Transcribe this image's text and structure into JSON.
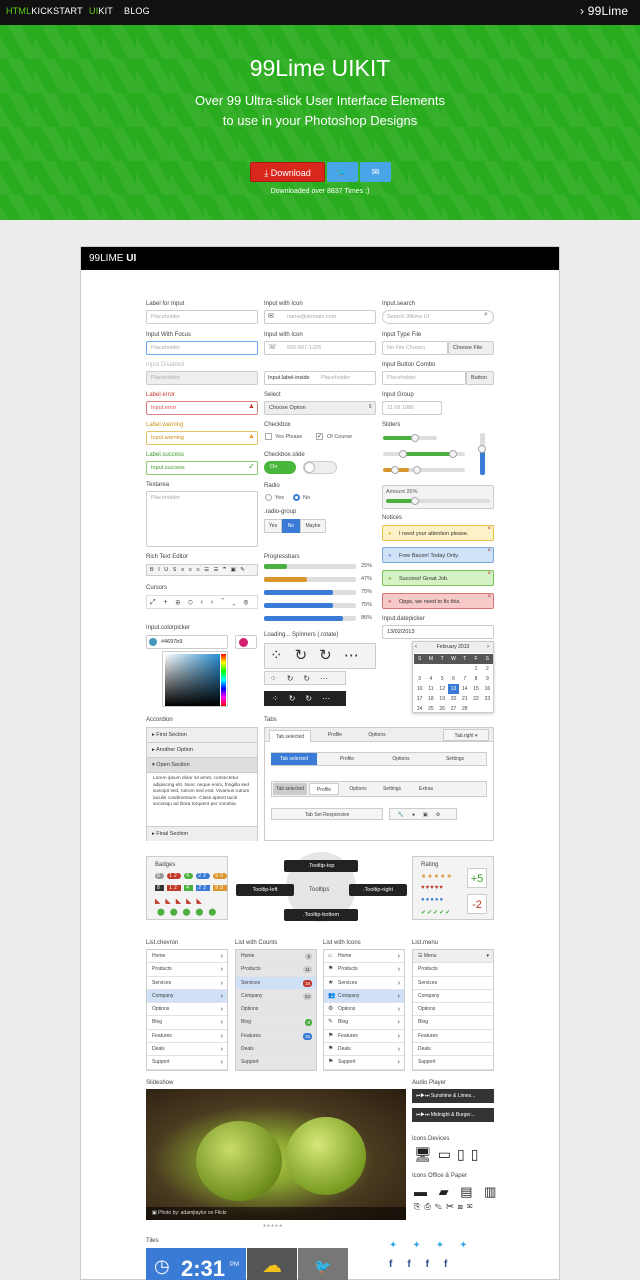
{
  "nav": {
    "brand_a": "HTML",
    "brand_b": "KICKSTART",
    "ui_a": "UI",
    "ui_b": "KIT",
    "blog": "BLOG",
    "logo": "› 99Lime"
  },
  "hero": {
    "title": "99Lime UIKIT",
    "subtitle1": "Over 99 Ultra-slick User Interface Elements",
    "subtitle2": "to use in your Photoshop Designs",
    "download": "Download",
    "downloaded": "Downloaded over 8837 Times :)"
  },
  "card": {
    "title_a": "99LIME ",
    "title_b": "UI"
  },
  "form": {
    "c1": [
      {
        "label": "Label for Input",
        "ph": "Placeholder"
      },
      {
        "label": "Input With Focus",
        "ph": "Placeholder"
      },
      {
        "label": "Input Disabled",
        "ph": "Placeholder"
      },
      {
        "label": "Label.error",
        "ph": "Input.error"
      },
      {
        "label": "Label.warning",
        "ph": "Input.warning"
      },
      {
        "label": "Label.success",
        "ph": "Input.success"
      }
    ],
    "textarea_label": "Textarea",
    "textarea_ph": "Placeholder",
    "c2": [
      {
        "label": "Input with Icon",
        "ph": "name@domain.com"
      },
      {
        "label": "Input with Icon",
        "ph": "555-567-1205"
      },
      {
        "label": "",
        "prefix": "Input.label-inside",
        "ph": "Placeholder"
      },
      {
        "label": "Select",
        "ph": "Choose Option"
      }
    ],
    "checkbox_label": "Checkbox",
    "cb1": "Yes Please",
    "cb2": "Of Course",
    "slide_label": "Checkbox.slide",
    "on": "On",
    "radio_label": "Radio",
    "r1": "Yes",
    "r2": "No",
    "radiogroup_label": ".radio-group",
    "rg": [
      "Yes",
      "No",
      "Maybe"
    ],
    "c3": [
      {
        "label": "Input.search",
        "ph": "Search 99lime UI"
      },
      {
        "label": "Input Type File",
        "ph": "No File Chosen",
        "btn": "Choose File"
      },
      {
        "label": "Input Button Combo",
        "ph": "Placeholder",
        "btn": "Button"
      },
      {
        "label": "Input Group",
        "ph": "11   09   1980"
      }
    ],
    "sliders_label": "Sliders",
    "amount": "Amount  26%"
  },
  "notices": {
    "label": "Notices",
    "items": [
      {
        "text": "I need your attention please.",
        "bg": "#fdf1c8",
        "bd": "#e4c24a"
      },
      {
        "text": "Free Bacon! Today Only.",
        "bg": "#cfe2f7",
        "bd": "#7aa6dc"
      },
      {
        "text": "Success! Great Job.",
        "bg": "#d4f2c4",
        "bd": "#7cc35a"
      },
      {
        "text": "Opps, we need to fix this.",
        "bg": "#f7c9c9",
        "bd": "#d97474"
      }
    ]
  },
  "rte": {
    "label": "Rich Text Editor",
    "cursors": "Cursors"
  },
  "progress": {
    "label": "Progressbars",
    "items": [
      {
        "v": 25,
        "t": "25%",
        "c": "#4caf3f"
      },
      {
        "v": 47,
        "t": "47%",
        "c": "#d9962e"
      },
      {
        "v": 75,
        "t": "75%",
        "c": "#3a7bd5"
      },
      {
        "v": 75,
        "t": "75%",
        "c": "#3a7bd5"
      },
      {
        "v": 86,
        "t": "86%",
        "c": "#3a7bd5"
      }
    ]
  },
  "color": {
    "label": "Input.colorpicker",
    "value": "#4697b9"
  },
  "spinners": {
    "label": "Loading... Spinners (.rotate)"
  },
  "datepicker": {
    "label": "Input.datepicker",
    "value": "13/02/2013",
    "month": "February 2013",
    "days": [
      "S",
      "M",
      "T",
      "W",
      "T",
      "F",
      "S"
    ],
    "rows": [
      [
        "",
        "",
        "",
        "",
        "",
        "1",
        "2"
      ],
      [
        "3",
        "4",
        "5",
        "6",
        "7",
        "8",
        "9"
      ],
      [
        "10",
        "11",
        "12",
        "13",
        "14",
        "15",
        "16"
      ],
      [
        "17",
        "18",
        "19",
        "20",
        "21",
        "22",
        "23"
      ],
      [
        "24",
        "25",
        "26",
        "27",
        "28",
        "",
        ""
      ]
    ]
  },
  "accordion": {
    "label": "Accordion",
    "items": [
      "First Section",
      "Another Option",
      "Open Section",
      "Final Section"
    ],
    "body": "Lorem ipsum dolor sit amet, consectetur adipiscing elit. Nunc neque enim, fringilla sed suscipit sed, rutrum sed erat. Vivamus rutrum iaculis condimentum. Class aptent taciti sociosqu ad litora torquent per conubia"
  },
  "tabs": {
    "label": "Tabs",
    "t1": [
      "Tab.selected",
      "Profile",
      "Options"
    ],
    "t1r": "Tab.right ▾",
    "t2": [
      "Tab selected",
      "Profile",
      "Options",
      "Settings"
    ],
    "t3": [
      "Tab selected",
      "Profile",
      "Options",
      "Settings",
      "Extras"
    ],
    "t4": "Tab Set Responsive"
  },
  "badges": {
    "label": "Badges"
  },
  "tooltips": {
    "center": "Tooltips",
    "top": ".Tooltip-top",
    "left": "Tooltip-left",
    "right": ".Tooltip-right",
    "bottom": ".Tooltip-bottom"
  },
  "rating": {
    "label": "Rating",
    "plus": "+5",
    "minus": "-2"
  },
  "lists": {
    "chevron": {
      "label": "List.chevron",
      "items": [
        "Home",
        "Products",
        "Services",
        "Company",
        "Options",
        "Blog",
        "Features",
        "Deals",
        "Support"
      ]
    },
    "counts": {
      "label": "List with Counts",
      "items": [
        "Home",
        "Products",
        "Services",
        "Company",
        "Options",
        "Blog",
        "Features",
        "Deals",
        "Support"
      ],
      "counts": [
        "8",
        "11",
        "16",
        "24",
        "",
        "8",
        "15",
        "",
        ""
      ]
    },
    "icons": {
      "label": "List with Icons",
      "items": [
        "Home",
        "Products",
        "Services",
        "Company",
        "Options",
        "Blog",
        "Features",
        "Deals",
        "Support"
      ]
    },
    "menu": {
      "label": "List.menu",
      "items": [
        "Menu",
        "Products",
        "Services",
        "Company",
        "Options",
        "Blog",
        "Features",
        "Deals",
        "Support"
      ]
    }
  },
  "slideshow": {
    "label": "Slideshow",
    "caption": "Photo by: adamjtaylor on Flickr"
  },
  "audio": {
    "label": "Audio Player",
    "t1": "Sunshine & Limes...",
    "t2": "Midnight & Burger..."
  },
  "icons_devices": "Icons Devices",
  "icons_office": "Icons Office & Paper",
  "tiles": {
    "label": "Tiles",
    "time": "2:31",
    "pm": "PM"
  }
}
